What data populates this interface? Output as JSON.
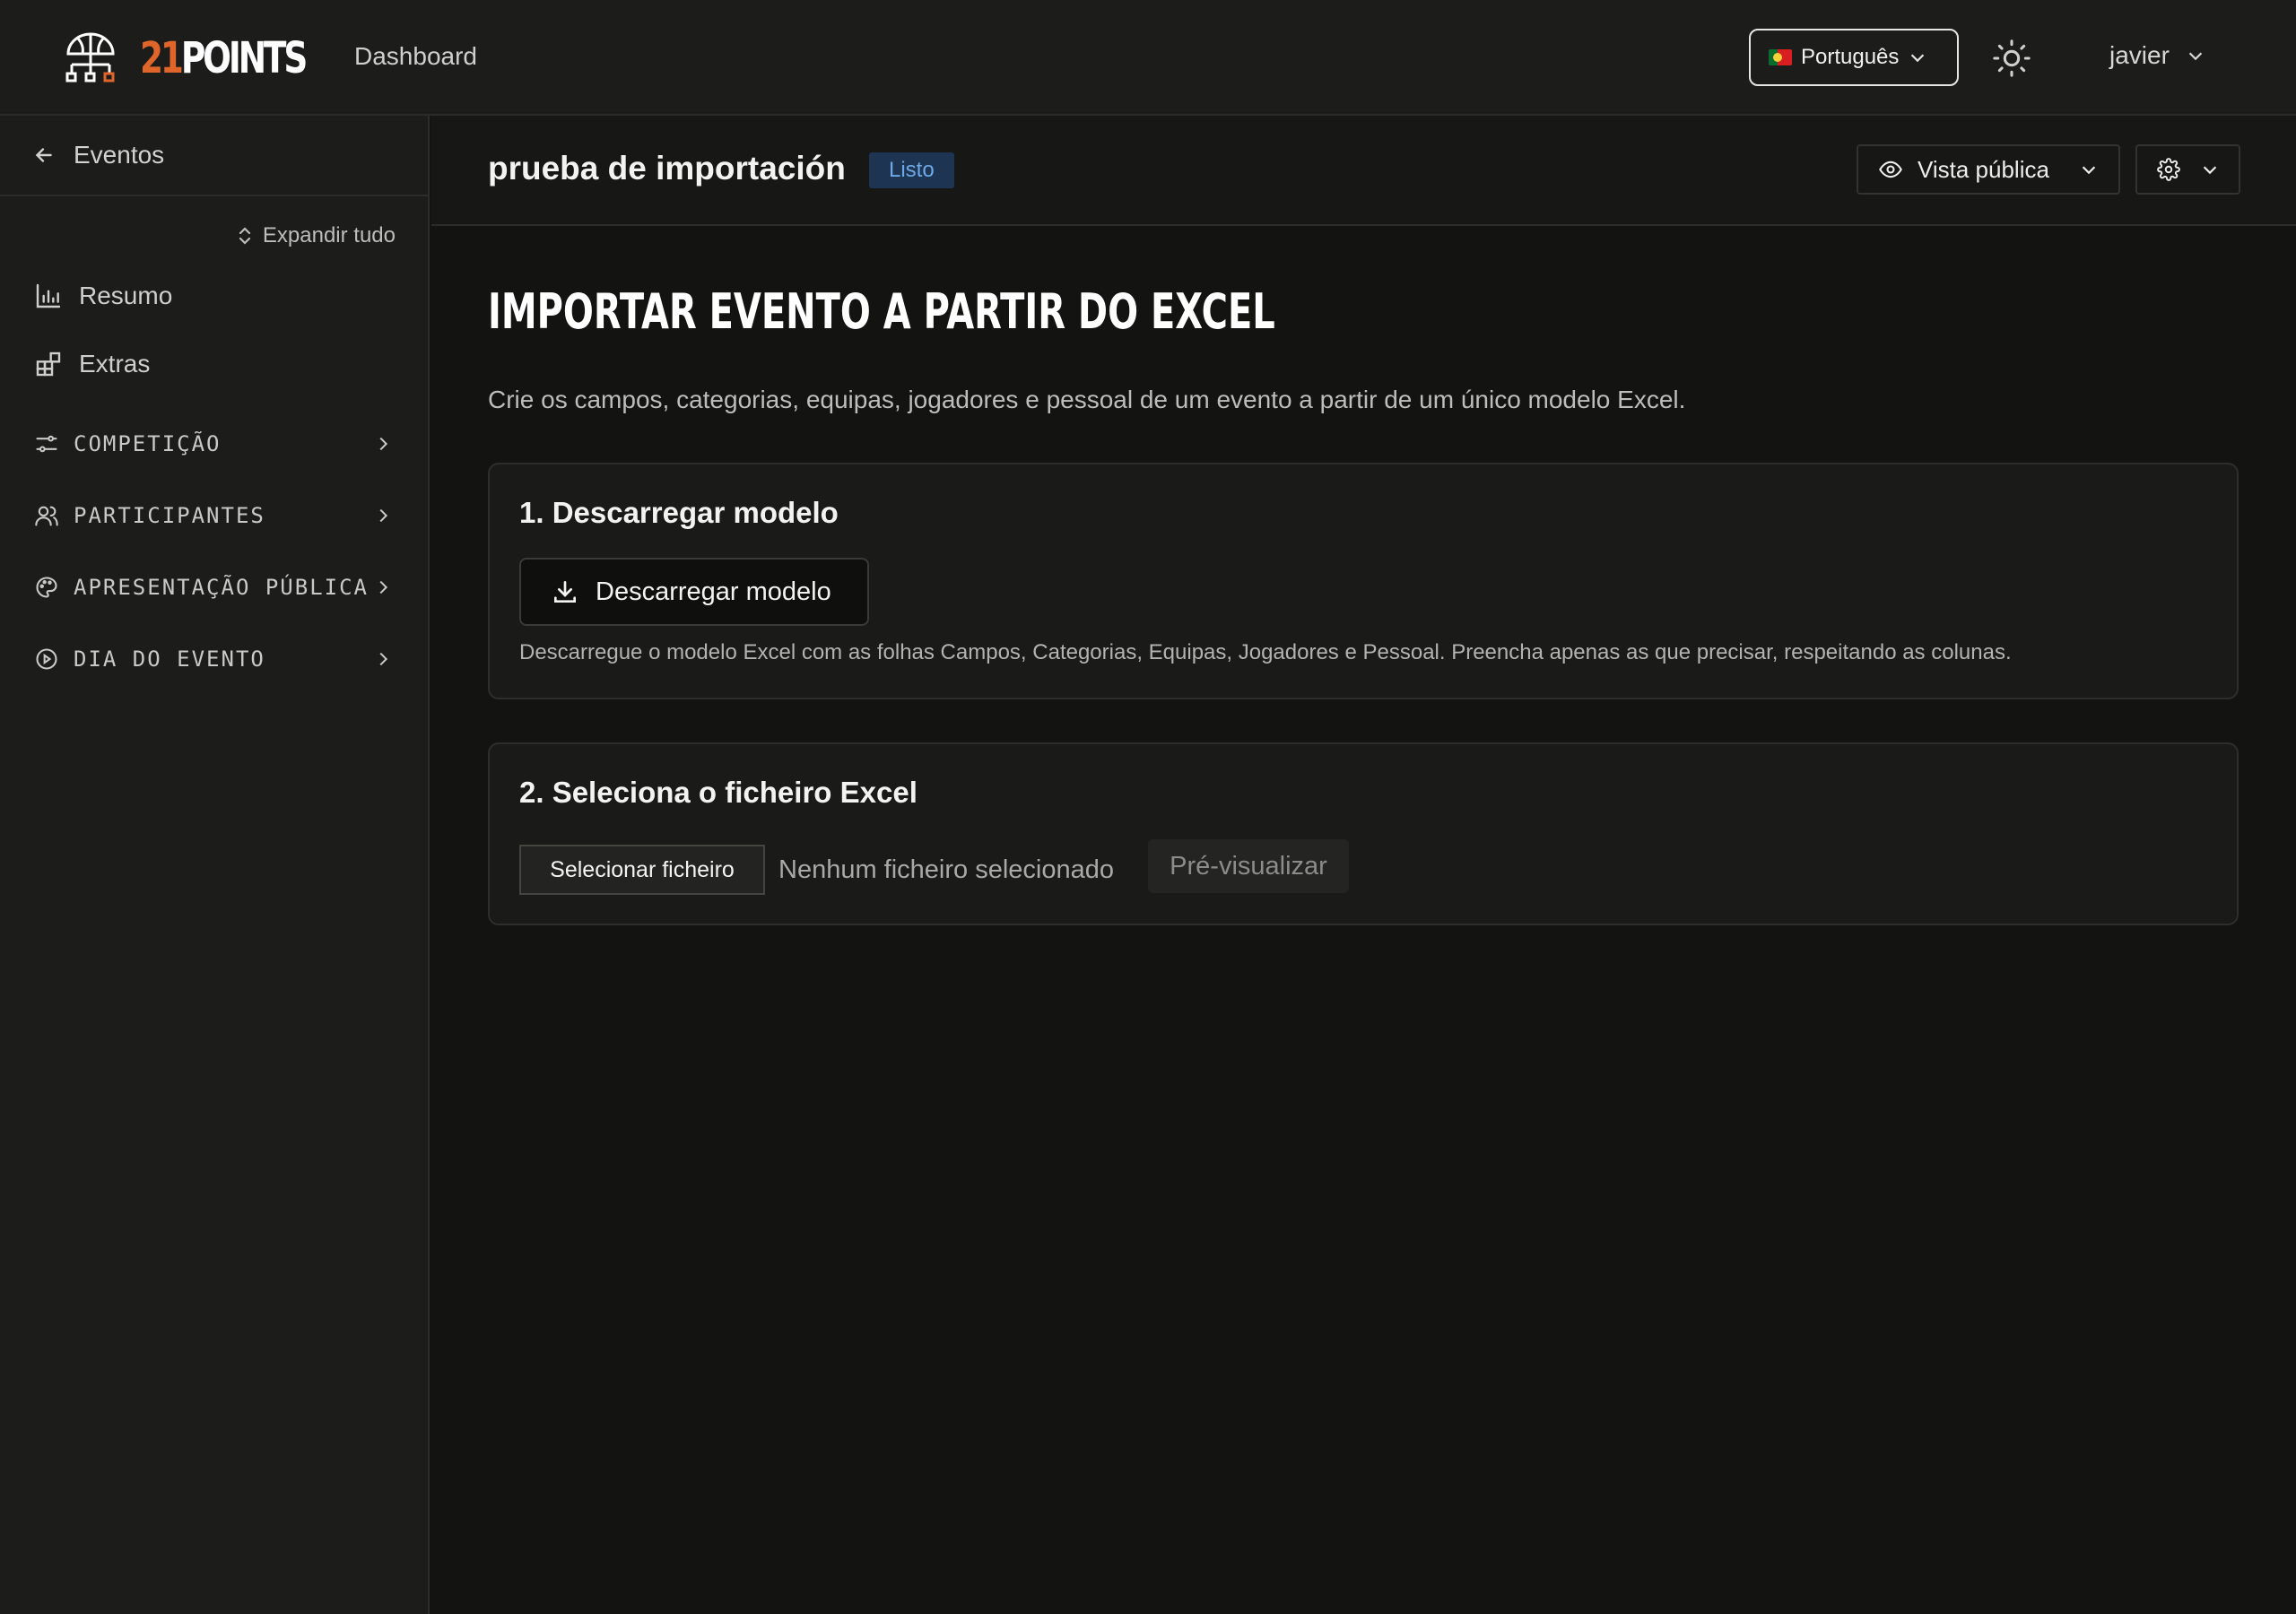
{
  "topbar": {
    "logo_num": "21",
    "logo_word": "POINTS",
    "dashboard_link": "Dashboard",
    "language": "Português",
    "user": "javier"
  },
  "sidebar": {
    "back_label": "Eventos",
    "expand_all": "Expandir tudo",
    "items": [
      {
        "label": "Resumo",
        "icon": "bar-chart-icon"
      },
      {
        "label": "Extras",
        "icon": "blocks-icon"
      }
    ],
    "groups": [
      {
        "label": "COMPETIÇÃO",
        "icon": "sliders-icon"
      },
      {
        "label": "PARTICIPANTES",
        "icon": "users-icon"
      },
      {
        "label": "APRESENTAÇÃO PÚBLICA",
        "icon": "palette-icon"
      },
      {
        "label": "DIA DO EVENTO",
        "icon": "play-circle-icon"
      }
    ]
  },
  "header": {
    "event_title": "prueba de importación",
    "status": "Listo",
    "public_view": "Vista pública"
  },
  "main": {
    "title": "IMPORTAR EVENTO A PARTIR DO EXCEL",
    "description": "Crie os campos, categorias, equipas, jogadores e pessoal de um evento a partir de um único modelo Excel.",
    "step1": {
      "title": "1. Descarregar modelo",
      "button": "Descarregar modelo",
      "help": "Descarregue o modelo Excel com as folhas Campos, Categorias, Equipas, Jogadores e Pessoal. Preencha apenas as que precisar, respeitando as colunas."
    },
    "step2": {
      "title": "2. Seleciona o ficheiro Excel",
      "file_button": "Selecionar ficheiro",
      "file_status": "Nenhum ficheiro selecionado",
      "preview_button": "Pré-visualizar"
    }
  },
  "colors": {
    "accent": "#e0652a",
    "badge_bg": "#1d3553",
    "badge_text": "#6ea8e6",
    "background": "#131312",
    "panel": "#1c1c1b"
  }
}
